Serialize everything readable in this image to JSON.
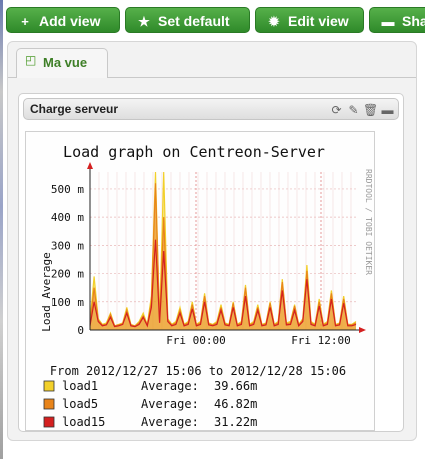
{
  "toolbar": {
    "buttons": [
      {
        "label": "Add view",
        "icon": "plus-icon"
      },
      {
        "label": "Set default",
        "icon": "star-icon"
      },
      {
        "label": "Edit view",
        "icon": "gear-icon"
      },
      {
        "label": "Sha",
        "icon": "folder-icon"
      }
    ]
  },
  "tabs": [
    {
      "label": "Ma vue"
    }
  ],
  "widget": {
    "title": "Charge serveur",
    "icons": [
      "refresh-icon",
      "wrench-icon",
      "trash-icon",
      "minimize-icon"
    ]
  },
  "chart_data": {
    "type": "line",
    "title": "Load graph on Centreon-Server",
    "ylabel": "Load_Average",
    "side_label": "RRDTOOL / TOBI OETIKER",
    "ylim": [
      0,
      560
    ],
    "yticks": [
      "0",
      "100 m",
      "200 m",
      "300 m",
      "400 m",
      "500 m"
    ],
    "xticks": [
      "Fri 00:00",
      "Fri 12:00"
    ],
    "range_text": "From 2012/12/27 15:06 to 2012/12/28 15:06",
    "grid": true,
    "series": [
      {
        "name": "load1",
        "color": "#f2d02a",
        "values": [
          30,
          190,
          40,
          20,
          25,
          60,
          15,
          20,
          25,
          80,
          20,
          15,
          30,
          60,
          20,
          120,
          560,
          30,
          560,
          40,
          20,
          30,
          80,
          20,
          30,
          100,
          20,
          30,
          130,
          25,
          20,
          30,
          90,
          25,
          20,
          100,
          20,
          30,
          160,
          20,
          30,
          90,
          20,
          25,
          100,
          20,
          30,
          180,
          25,
          30,
          90,
          20,
          40,
          230,
          30,
          20,
          110,
          20,
          30,
          140,
          20,
          25,
          120,
          20,
          20,
          30
        ]
      },
      {
        "name": "load5",
        "color": "#e8841a",
        "values": [
          20,
          150,
          35,
          18,
          20,
          55,
          15,
          18,
          22,
          70,
          18,
          14,
          25,
          50,
          18,
          100,
          520,
          30,
          400,
          35,
          18,
          25,
          70,
          18,
          25,
          90,
          18,
          25,
          120,
          22,
          18,
          25,
          80,
          22,
          18,
          95,
          18,
          25,
          150,
          18,
          25,
          80,
          18,
          22,
          95,
          18,
          25,
          170,
          22,
          25,
          85,
          18,
          35,
          210,
          25,
          18,
          100,
          18,
          25,
          130,
          18,
          22,
          110,
          18,
          18,
          25
        ]
      },
      {
        "name": "load15",
        "color": "#d42020",
        "values": [
          15,
          100,
          30,
          15,
          18,
          45,
          12,
          15,
          20,
          60,
          15,
          12,
          20,
          45,
          15,
          80,
          320,
          25,
          280,
          30,
          15,
          20,
          60,
          15,
          20,
          75,
          15,
          20,
          100,
          18,
          15,
          20,
          70,
          18,
          15,
          80,
          15,
          20,
          120,
          15,
          20,
          70,
          15,
          18,
          80,
          15,
          20,
          140,
          18,
          20,
          70,
          15,
          30,
          180,
          20,
          15,
          85,
          15,
          20,
          110,
          15,
          18,
          95,
          15,
          15,
          20
        ]
      }
    ],
    "legend": [
      {
        "name": "load1",
        "avg_label": "Average:",
        "avg": "39.66m",
        "color": "#f2d02a"
      },
      {
        "name": "load5",
        "avg_label": "Average:",
        "avg": "46.82m",
        "color": "#e8841a"
      },
      {
        "name": "load15",
        "avg_label": "Average:",
        "avg": "31.22m",
        "color": "#d42020"
      }
    ]
  }
}
